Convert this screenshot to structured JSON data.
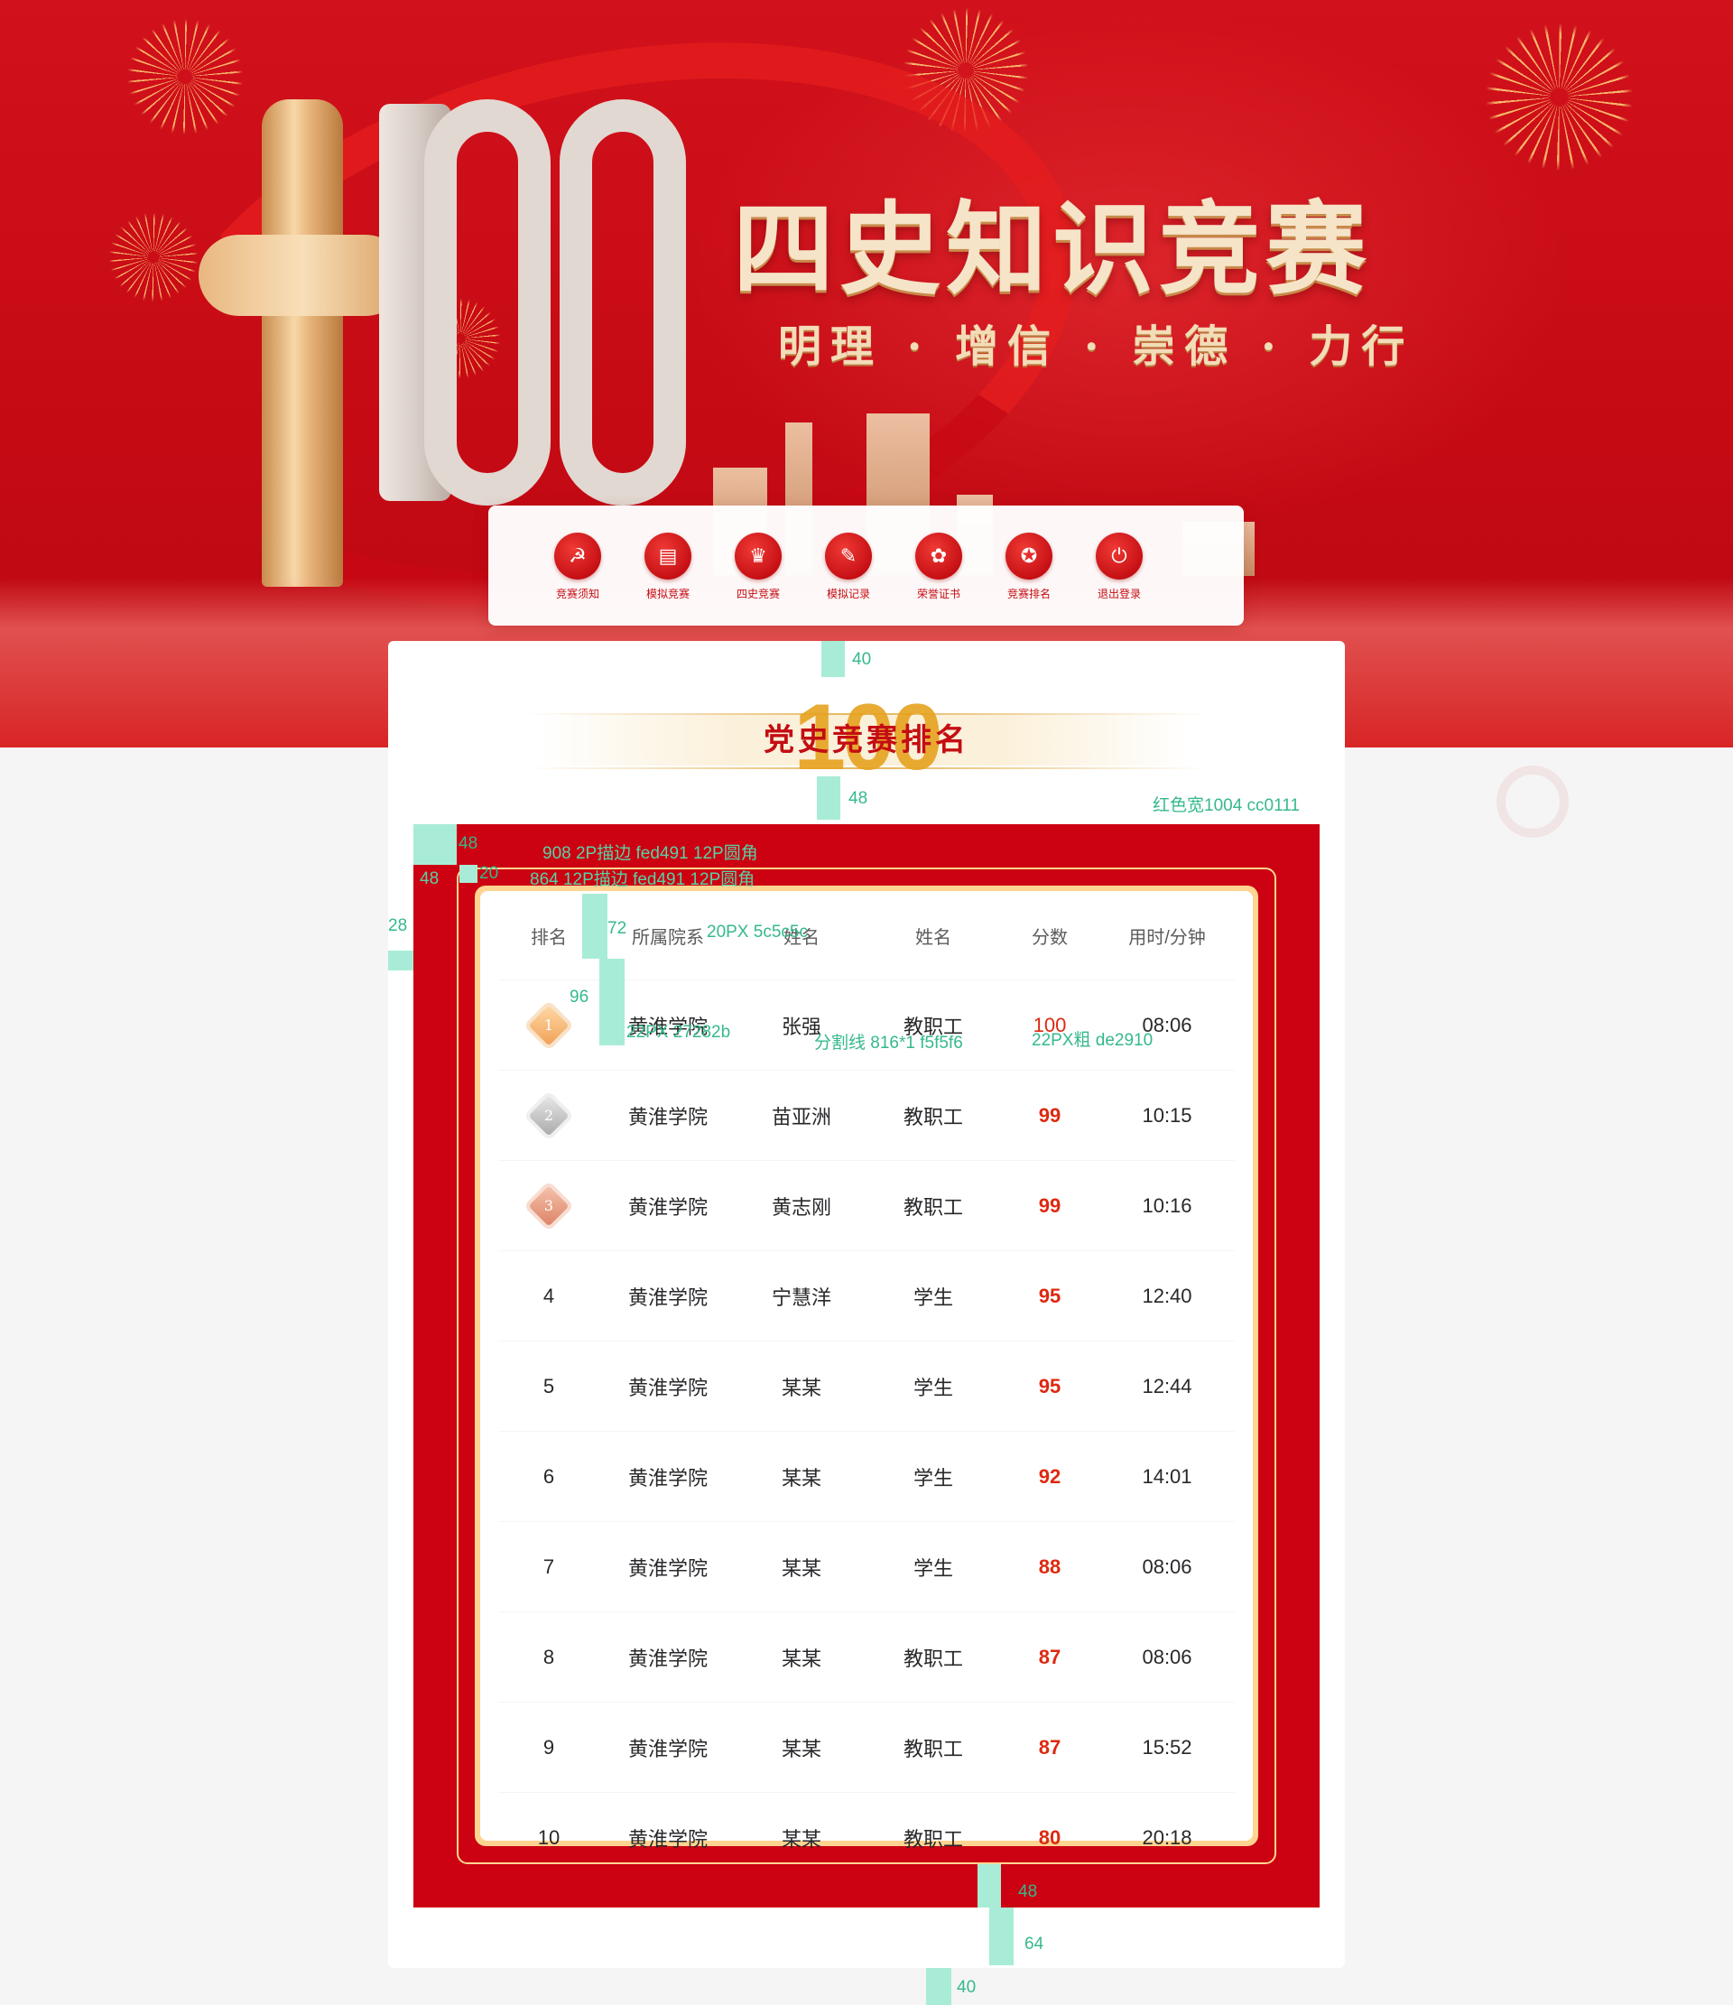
{
  "hero": {
    "title": "四史知识竞赛",
    "slogan": "明理 · 增信 · 崇德 · 力行"
  },
  "nav": [
    {
      "label": "竞赛须知",
      "icon": "hammer-sickle-icon",
      "glyph": "☭"
    },
    {
      "label": "模拟竞赛",
      "icon": "book-stack-icon",
      "glyph": "▤"
    },
    {
      "label": "四史竞赛",
      "icon": "trophy-icon",
      "glyph": "♛"
    },
    {
      "label": "模拟记录",
      "icon": "reader-icon",
      "glyph": "✎"
    },
    {
      "label": "荣誉证书",
      "icon": "rosette-icon",
      "glyph": "✿"
    },
    {
      "label": "竞赛排名",
      "icon": "medal-icon",
      "glyph": "✪"
    },
    {
      "label": "退出登录",
      "icon": "power-icon",
      "glyph": "⏻"
    }
  ],
  "ranking": {
    "title": "党史竞赛排名",
    "watermark_number": "100",
    "columns": [
      "排名",
      "所属院系",
      "姓名",
      "姓名",
      "分数",
      "用时/分钟"
    ],
    "rows": [
      {
        "rank": "1",
        "dept": "黄淮学院",
        "name": "张强",
        "role": "教职工",
        "score": "100",
        "time": "08:06"
      },
      {
        "rank": "2",
        "dept": "黄淮学院",
        "name": "苗亚洲",
        "role": "教职工",
        "score": "99",
        "time": "10:15"
      },
      {
        "rank": "3",
        "dept": "黄淮学院",
        "name": "黄志刚",
        "role": "教职工",
        "score": "99",
        "time": "10:16"
      },
      {
        "rank": "4",
        "dept": "黄淮学院",
        "name": "宁慧洋",
        "role": "学生",
        "score": "95",
        "time": "12:40"
      },
      {
        "rank": "5",
        "dept": "黄淮学院",
        "name": "某某",
        "role": "学生",
        "score": "95",
        "time": "12:44"
      },
      {
        "rank": "6",
        "dept": "黄淮学院",
        "name": "某某",
        "role": "学生",
        "score": "92",
        "time": "14:01"
      },
      {
        "rank": "7",
        "dept": "黄淮学院",
        "name": "某某",
        "role": "学生",
        "score": "88",
        "time": "08:06"
      },
      {
        "rank": "8",
        "dept": "黄淮学院",
        "name": "某某",
        "role": "教职工",
        "score": "87",
        "time": "08:06"
      },
      {
        "rank": "9",
        "dept": "黄淮学院",
        "name": "某某",
        "role": "教职工",
        "score": "87",
        "time": "15:52"
      },
      {
        "rank": "10",
        "dept": "黄淮学院",
        "name": "某某",
        "role": "教职工",
        "score": "80",
        "time": "20:18"
      }
    ]
  },
  "annotations": {
    "a40_top": "40",
    "a48_header": "48",
    "red_width": "红色宽1004 cc0111",
    "a48_outline": "48",
    "outline_spec": "908 2P描边 fed491 12P圆角",
    "a48_left": "48",
    "a20": "20",
    "inner_spec": "864 12P描边 fed491 12P圆角",
    "a28": "28",
    "a72": "72",
    "header_spec": "20PX 5c5c5c",
    "a96": "96",
    "cell_spec": "22PX 27282b",
    "divider_spec": "分割线 816*1 f5f5f6",
    "score_spec": "22PX粗 de2910",
    "a48_bottom": "48",
    "a64": "64",
    "a40_bottom": "40"
  },
  "colors": {
    "brand_red": "#cc0111",
    "gold_border": "#fed491",
    "score_red": "#de2910",
    "header_text": "#5c5c5c",
    "cell_text": "#27282b",
    "divider": "#f5f5f6",
    "annotation": "#35b98b"
  }
}
